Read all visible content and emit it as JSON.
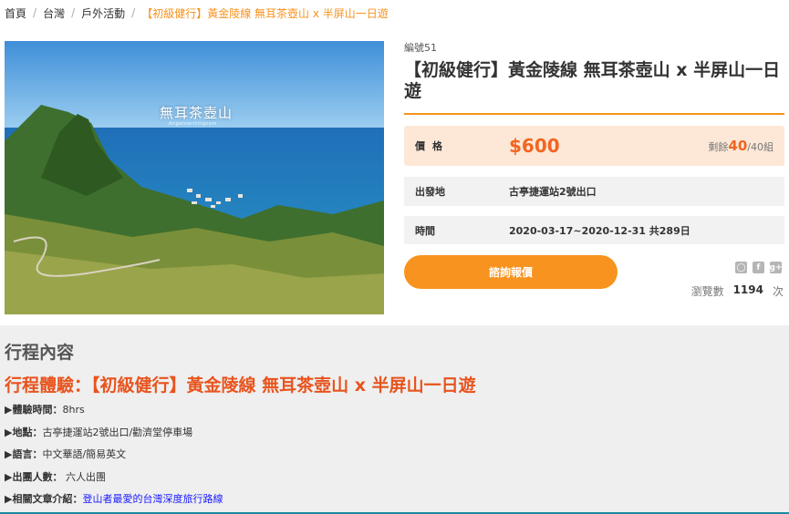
{
  "breadcrumb": {
    "items": [
      "首頁",
      "台灣",
      "戶外活動"
    ],
    "current": "【初級健行】黃金陵線 無耳茶壺山 x 半屏山一日遊"
  },
  "hero": {
    "caption": "無耳茶壺山",
    "watermark": "Angelswritingcom"
  },
  "product": {
    "serial": "編號51",
    "title": "【初級健行】黃金陵線 無耳茶壺山 x 半屏山一日遊",
    "price_label": "價格",
    "price": "$600",
    "remain_prefix": "剩餘",
    "remain_count": "40",
    "remain_suffix": "/40組",
    "depart_label": "出發地",
    "depart_value": "古亭捷運站2號出口",
    "time_label": "時間",
    "time_value": "2020-03-17~2020-12-31 共289日",
    "inquire_button": "諮詢報價",
    "views_label": "瀏覽數",
    "views_count": "1194",
    "views_unit": "次"
  },
  "share": {
    "icons": [
      "line-icon",
      "facebook-icon",
      "google-plus-icon"
    ],
    "glyphs": [
      "◯",
      "f",
      "g+"
    ]
  },
  "itinerary": {
    "section_title": "行程內容",
    "experience_title": "行程體驗：【初級健行】黃金陵線 無耳茶壺山 x 半屏山一日遊",
    "details": [
      {
        "key": "▶體驗時間：",
        "value": "8hrs"
      },
      {
        "key": "▶地點：",
        "value": "古亭捷運站2號出口/勸濟堂停車場"
      },
      {
        "key": "▶語言：",
        "value": "中文華語/簡易英文"
      },
      {
        "key": "▶出團人數：",
        "value": " 六人出團"
      },
      {
        "key": "▶相關文章介紹：",
        "value": "登山者最愛的台灣深度旅行路線"
      }
    ]
  },
  "colors": {
    "accent": "#f7931e",
    "price": "#f26522",
    "price_row_bg": "#fde8d7",
    "link": "#1a1aff",
    "section_bg": "#efefef"
  }
}
